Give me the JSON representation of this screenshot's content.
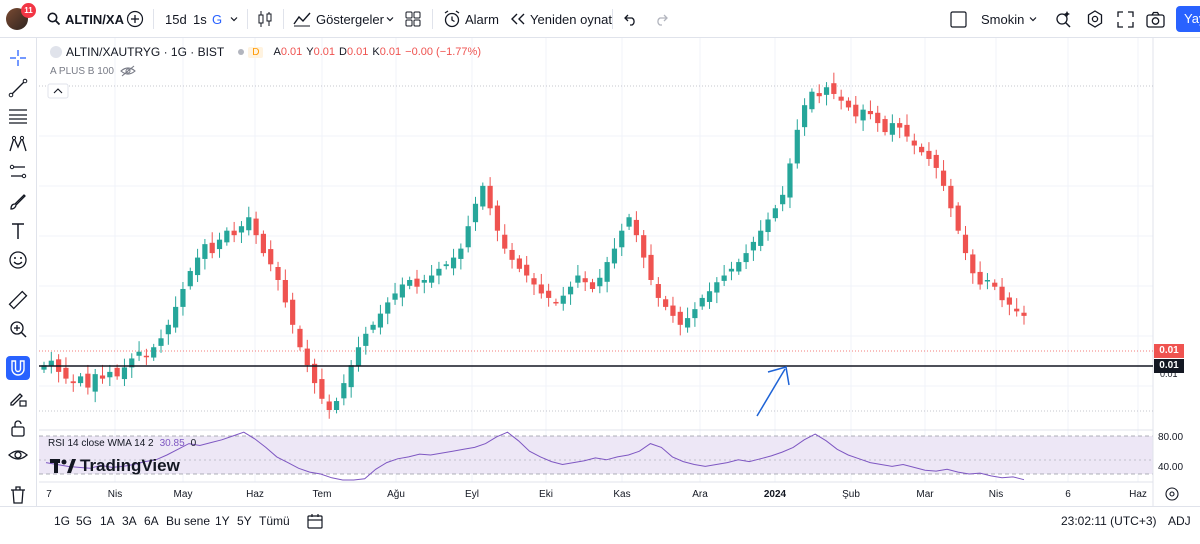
{
  "topbar": {
    "notifications": "11",
    "symbol": "ALTIN/XA",
    "interval_primary": "15d",
    "interval_secondary": "1s",
    "interval_active": "G",
    "indicators_label": "Göstergeler",
    "alarm_label": "Alarm",
    "replay_label": "Yeniden oynat",
    "layout_name": "Smokin",
    "publish_label": "Yay"
  },
  "legend": {
    "title": "ALTIN/XAUTRYG · 1G · BIST",
    "badge": "D",
    "open_label": "A",
    "open": "0.01",
    "high_label": "Y",
    "high": "0.01",
    "low_label": "D",
    "low": "0.01",
    "close_label": "K",
    "close": "0.01",
    "change": "−0.00 (−1.77%)",
    "sub_label": "A PLUS B 100"
  },
  "price_axis": {
    "last_price": "0.01",
    "crosshair_price": "0.01",
    "below_label": "0.01"
  },
  "rsi": {
    "label": "RSI 14 close WMA 14 2",
    "value": "30.85",
    "second_value": "0",
    "upper": "80.00",
    "lower": "40.00"
  },
  "time_axis": [
    "7",
    "Nis",
    "May",
    "Haz",
    "Tem",
    "Ağu",
    "Eyl",
    "Eki",
    "Kas",
    "Ara",
    "2024",
    "Şub",
    "Mar",
    "Nis",
    "6",
    "Haz"
  ],
  "bottombar": {
    "ranges": [
      "1G",
      "5G",
      "1A",
      "3A",
      "6A",
      "Bu sene",
      "1Y",
      "5Y",
      "Tümü"
    ],
    "time": "23:02:11 (UTC+3)",
    "adj": "ADJ"
  },
  "watermark": "TradingView",
  "colors": {
    "up": "#26a69a",
    "down": "#ef5350",
    "rsi_line": "#7e57c2",
    "rsi_band": "#ede7f6",
    "accent": "#2962ff",
    "arrow": "#1e63d6"
  },
  "chart_data": {
    "type": "candlestick",
    "closes": [
      100,
      102,
      97,
      94,
      92,
      95,
      90,
      96,
      94,
      97,
      95,
      99,
      103,
      106,
      104,
      108,
      112,
      118,
      126,
      134,
      142,
      148,
      154,
      150,
      156,
      160,
      158,
      162,
      166,
      158,
      150,
      145,
      138,
      128,
      118,
      108,
      100,
      92,
      85,
      80,
      84,
      92,
      100,
      108,
      114,
      118,
      123,
      128,
      132,
      136,
      138,
      135,
      138,
      140,
      143,
      145,
      148,
      152,
      162,
      172,
      180,
      170,
      160,
      152,
      147,
      143,
      140,
      136,
      132,
      130,
      128,
      131,
      135,
      140,
      137,
      134,
      139,
      146,
      152,
      160,
      166,
      158,
      148,
      138,
      130,
      126,
      122,
      118,
      121,
      125,
      130,
      133,
      137,
      140,
      143,
      146,
      150,
      155,
      160,
      165,
      170,
      176,
      190,
      205,
      216,
      222,
      220,
      224,
      221,
      218,
      215,
      211,
      214,
      212,
      208,
      204,
      208,
      206,
      202,
      198,
      195,
      192,
      188,
      180,
      170,
      160,
      150,
      141,
      136,
      138,
      135,
      129,
      127,
      124,
      122
    ],
    "rsi": [
      52,
      50,
      48,
      47,
      46,
      49,
      47,
      48,
      50,
      53,
      55,
      60,
      66,
      72,
      70,
      73,
      76,
      80,
      84,
      77,
      68,
      58,
      52,
      46,
      42,
      40,
      36,
      31,
      30,
      35,
      45,
      52,
      56,
      58,
      61,
      60,
      62,
      64,
      66,
      68,
      72,
      79,
      84,
      75,
      64,
      58,
      53,
      50,
      52,
      54,
      57,
      55,
      58,
      60,
      64,
      72,
      68,
      58,
      53,
      50,
      48,
      50,
      52,
      55,
      53,
      56,
      59,
      63,
      68,
      76,
      82,
      75,
      66,
      60,
      56,
      52,
      50,
      48,
      50,
      47,
      44,
      43,
      45,
      42,
      40,
      41,
      38,
      36,
      37,
      34
    ],
    "ylabels": [
      "80.00",
      "40.00"
    ]
  }
}
